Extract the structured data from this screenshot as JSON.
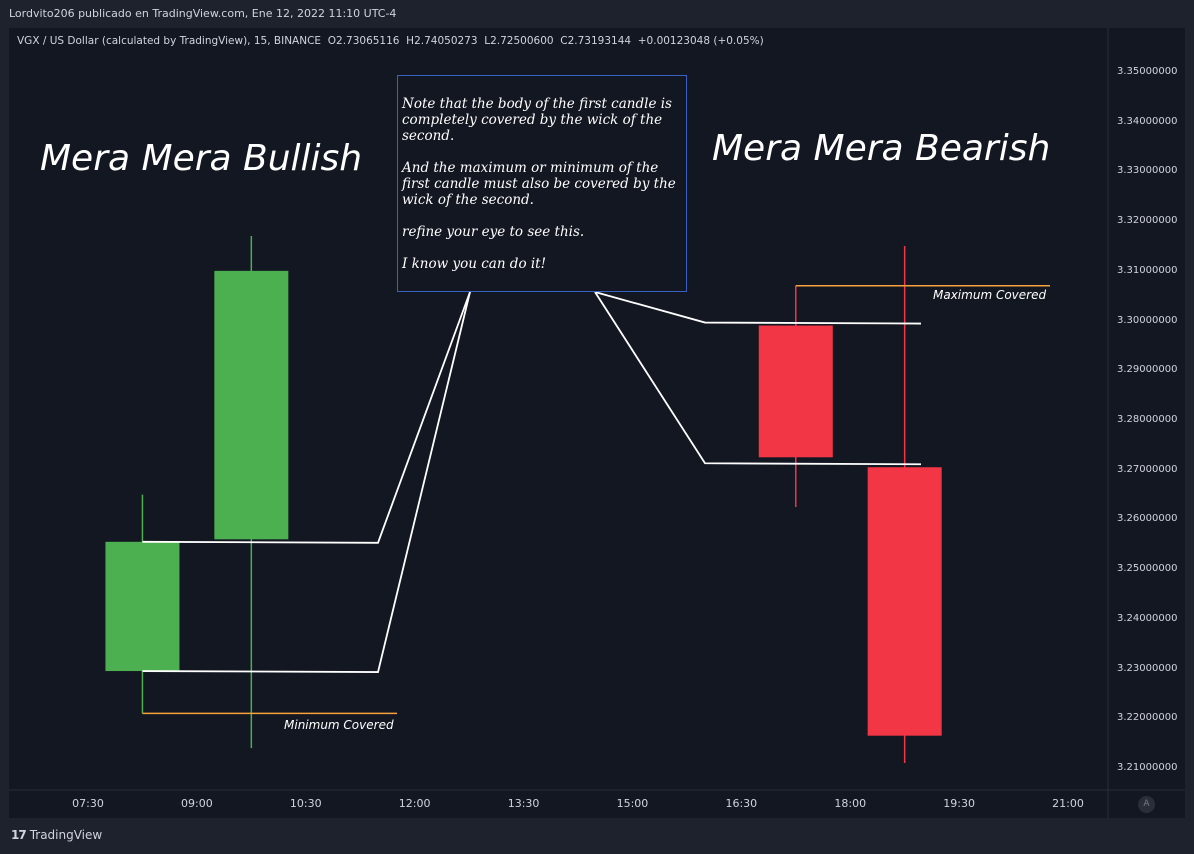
{
  "header": {
    "publisher": "Lordvito206 publicado en TradingView.com, Ene 12, 2022 11:10 UTC-4"
  },
  "legend": {
    "symbol": "VGX / US Dollar (calculated by TradingView), 15, BINANCE",
    "open_label": "O",
    "open": "2.73065116",
    "high_label": "H",
    "high": "2.74050273",
    "low_label": "L",
    "low": "2.72500600",
    "close_label": "C",
    "close": "2.73193144",
    "change": "+0.00123048 (+0.05%)"
  },
  "annotations": {
    "bullish_title": "Mera Mera Bullish",
    "bearish_title": "Mera Mera Bearish",
    "note_p1": "Note that the body of the first candle is completely covered by the wick of the second.",
    "note_p2": "And the maximum or minimum of the first candle must also be covered by the wick of the second.",
    "note_p3": "refine your eye to see this.",
    "note_p4": "I know you can do it!",
    "minimum_covered": "Minimum Covered",
    "maximum_covered": "Maximum Covered"
  },
  "footer": {
    "brand": "TradingView",
    "logo_glyph": "17",
    "auto_button": "A"
  },
  "colors": {
    "bullish": "#4caf50",
    "bearish": "#f23645",
    "background": "#131722",
    "orange_line": "#f7a23b",
    "note_border": "#3861c2"
  },
  "chart_data": {
    "type": "candlestick",
    "ylim": [
      3.205,
      3.357
    ],
    "y_ticks": [
      "3.35000000",
      "3.34000000",
      "3.33000000",
      "3.32000000",
      "3.31000000",
      "3.30000000",
      "3.29000000",
      "3.28000000",
      "3.27000000",
      "3.26000000",
      "3.25000000",
      "3.24000000",
      "3.23000000",
      "3.22000000",
      "3.21000000"
    ],
    "x_ticks": [
      "07:30",
      "09:00",
      "10:30",
      "12:00",
      "13:30",
      "15:00",
      "16:30",
      "18:00",
      "19:30",
      "21:00"
    ],
    "candles": [
      {
        "time": "08:15",
        "open": 3.2295,
        "high": 3.265,
        "low": 3.221,
        "close": 3.2555,
        "direction": "bullish"
      },
      {
        "time": "09:45",
        "open": 3.256,
        "high": 3.317,
        "low": 3.214,
        "close": 3.31,
        "direction": "bullish"
      },
      {
        "time": "17:15",
        "open": 3.299,
        "high": 3.307,
        "low": 3.2625,
        "close": 3.2725,
        "direction": "bearish"
      },
      {
        "time": "18:45",
        "open": 3.2705,
        "high": 3.315,
        "low": 3.211,
        "close": 3.2165,
        "direction": "bearish"
      }
    ],
    "levels": [
      {
        "name": "minimum_covered",
        "value": 3.221
      },
      {
        "name": "maximum_covered",
        "value": 3.307
      }
    ]
  }
}
